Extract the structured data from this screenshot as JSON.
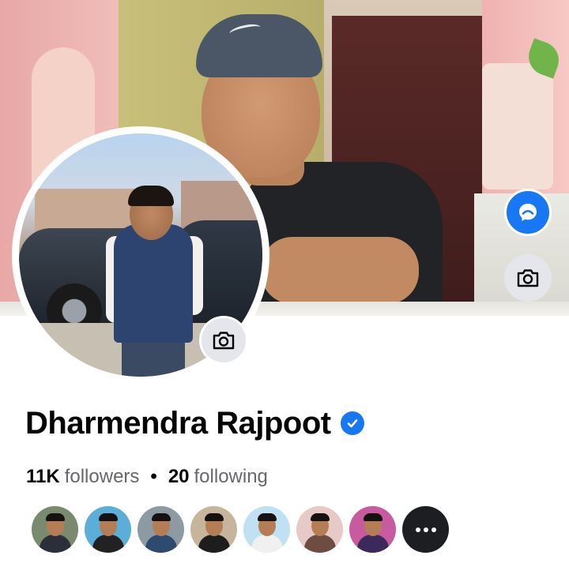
{
  "profile": {
    "name": "Dharmendra Rajpoot",
    "verified": true
  },
  "stats": {
    "followers_count": "11K",
    "followers_label": "followers",
    "separator": "•",
    "following_count": "20",
    "following_label": "following"
  },
  "icons": {
    "message_button": "messenger-icon",
    "cover_camera": "camera-icon",
    "profile_camera": "camera-icon",
    "verified_badge": "verified-check-icon",
    "more": "more-dots-icon"
  },
  "colors": {
    "accent": "#1877f2",
    "text_primary": "#050505",
    "text_secondary": "#65676b",
    "button_gray": "#e4e6eb"
  },
  "follower_avatars": [
    {
      "bg": "#7a8a6e",
      "shirt": "#2a2f3a"
    },
    {
      "bg": "#5aaed8",
      "shirt": "#222222"
    },
    {
      "bg": "#8d9aa3",
      "shirt": "#2e4a6e"
    },
    {
      "bg": "#c7b59b",
      "shirt": "#1d1d1d"
    },
    {
      "bg": "#bfe1f2",
      "shirt": "#f0f0f0"
    },
    {
      "bg": "#e7c9c7",
      "shirt": "#6d4c41"
    },
    {
      "bg": "#c85aa0",
      "shirt": "#3a2a5a"
    }
  ]
}
